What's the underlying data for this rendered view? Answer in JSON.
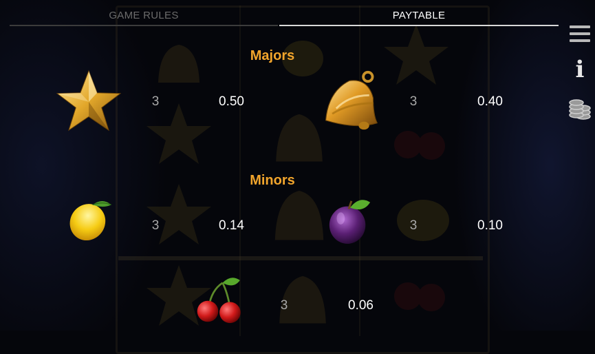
{
  "tabs": {
    "game_rules": "GAME RULES",
    "paytable": "PAYTABLE"
  },
  "sidebar": {
    "menu_icon": "hamburger-menu-icon",
    "info_icon": "info-icon",
    "coins_icon": "coin-stack-icon"
  },
  "paytable": {
    "majors": {
      "title": "Majors",
      "items": [
        {
          "symbol": "star",
          "count": "3",
          "payout": "0.50"
        },
        {
          "symbol": "bell",
          "count": "3",
          "payout": "0.40"
        }
      ]
    },
    "minors": {
      "title": "Minors",
      "items": [
        {
          "symbol": "lemon",
          "count": "3",
          "payout": "0.14"
        },
        {
          "symbol": "plum",
          "count": "3",
          "payout": "0.10"
        },
        {
          "symbol": "cherries",
          "count": "3",
          "payout": "0.06"
        }
      ]
    }
  },
  "colors": {
    "section_title": "#f2a52c",
    "background": "#05060b",
    "active_tab": "#ffffff",
    "inactive_tab": "#6b6b6b"
  }
}
